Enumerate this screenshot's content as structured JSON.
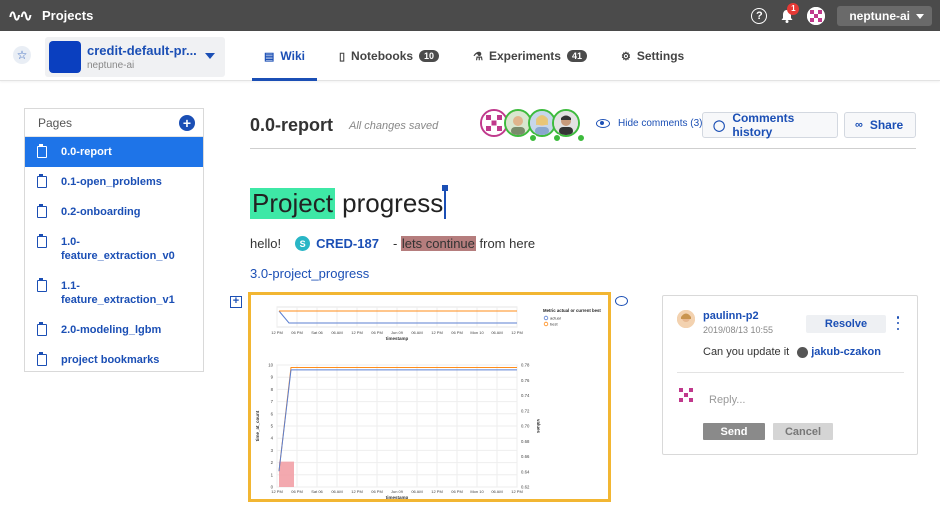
{
  "topbar": {
    "logo_icon": "neptune-logo-icon",
    "projects_label": "Projects",
    "notifications_count": "1",
    "user_name": "neptune-ai"
  },
  "project": {
    "name": "credit-default-pr...",
    "organization": "neptune-ai",
    "color": "#0a3fbf"
  },
  "tabs": [
    {
      "label": "Wiki",
      "icon": "clipboard-icon",
      "active": true
    },
    {
      "label": "Notebooks",
      "icon": "notebook-icon",
      "count": "10"
    },
    {
      "label": "Experiments",
      "icon": "flask-icon",
      "count": "41"
    },
    {
      "label": "Settings",
      "icon": "gear-icon"
    }
  ],
  "pages": {
    "header": "Pages",
    "items": [
      {
        "label": "0.0-report",
        "active": true
      },
      {
        "label": "0.1-open_problems"
      },
      {
        "label": "0.2-onboarding"
      },
      {
        "label": "1.0-feature_extraction_v0"
      },
      {
        "label": "1.1-feature_extraction_v1"
      },
      {
        "label": "2.0-modeling_lgbm"
      },
      {
        "label": "project bookmarks"
      }
    ]
  },
  "document": {
    "title": "0.0-report",
    "save_status": "All changes saved",
    "hide_comments": "Hide comments (3)",
    "comments_history": "Comments history",
    "share": "Share",
    "heading_highlighted": "Project",
    "heading_rest": " progress",
    "para_start": "hello!",
    "experiment_badge": "S",
    "experiment_id": "CRED-187",
    "para_dash": "- ",
    "para_highlighted": "lets continue",
    "para_end": " from here",
    "link": "3.0-project_progress"
  },
  "comment": {
    "user": "paulinn-p2",
    "date": "2019/08/13 10:55",
    "resolve": "Resolve",
    "text": "Can you update it",
    "mention": "jakub-czakon",
    "reply_placeholder": "Reply...",
    "send": "Send",
    "cancel": "Cancel"
  },
  "colors": {
    "accent": "#1b4fb5",
    "active_page": "#1e74e8",
    "highlight_green": "#3ee8a6",
    "highlight_brown": "#b57d7d",
    "chart_border": "#f2b632"
  },
  "chart_data": [
    {
      "type": "line",
      "xlabel": "timestamp",
      "x": [
        "12 PM",
        "06 PM",
        "Sat 06",
        "06 AM",
        "12 PM",
        "06 PM",
        "Jun 09",
        "06 AM",
        "12 PM",
        "06 PM",
        "Mon 10",
        "06 AM",
        "12 PM"
      ],
      "legend_title": "Metric actual or current best",
      "series": [
        {
          "name": "actual",
          "values": [
            1,
            0,
            0,
            0,
            0,
            0,
            0,
            0,
            0,
            0,
            0,
            0,
            0
          ]
        },
        {
          "name": "best",
          "values": [
            1,
            1,
            1,
            1,
            1,
            1,
            1,
            1,
            1,
            1,
            1,
            1,
            1
          ]
        }
      ]
    },
    {
      "type": "line",
      "xlabel": "timestamp",
      "ylabel": "time_at_count",
      "y2label": "values",
      "x": [
        "12 PM",
        "06 PM",
        "Sat 06",
        "06 AM",
        "12 PM",
        "06 PM",
        "Jun 09",
        "06 AM",
        "12 PM",
        "06 PM",
        "Mon 10",
        "06 AM",
        "12 PM"
      ],
      "yticks": [
        0,
        1,
        2,
        3,
        4,
        5,
        6,
        7,
        8,
        9,
        10
      ],
      "ylim": [
        0,
        10
      ],
      "y2ticks": [
        "0.62",
        "0.64",
        "0.66",
        "0.68",
        "0.70",
        "0.72",
        "0.74",
        "0.76",
        "0.78"
      ],
      "y2lim": [
        0.62,
        0.78
      ],
      "series": [
        {
          "values": [
            1.3,
            9.8,
            9.8,
            9.8,
            9.8,
            9.8,
            9.8,
            9.8,
            9.8,
            9.8,
            9.8,
            9.8,
            9.8
          ],
          "color": "#ff8c1a"
        },
        {
          "values": [
            1.3,
            9.6,
            9.6,
            9.6,
            9.6,
            9.6,
            9.6,
            9.6,
            9.6,
            9.6,
            9.6,
            9.6,
            9.6
          ],
          "color": "#5b7fd1"
        }
      ],
      "bar": {
        "x_range": [
          0,
          1
        ],
        "value": 1.3,
        "color": "#f2a0a6"
      }
    }
  ]
}
